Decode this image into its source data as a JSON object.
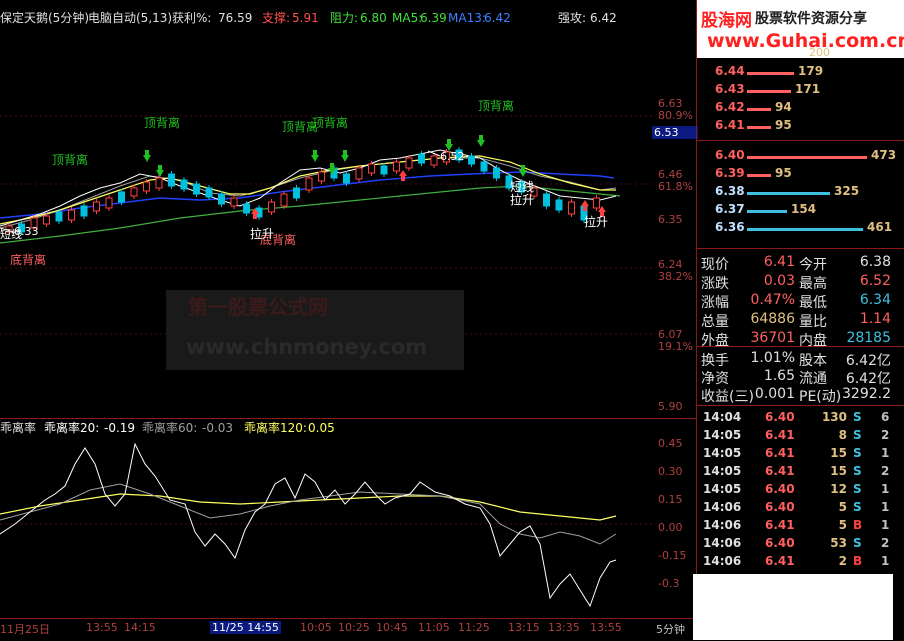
{
  "header": {
    "stock_name": "保定天鹅(5分钟)",
    "formula": "电脑自动(5,13)",
    "profit_label": "获利%:",
    "profit_value": "76.59",
    "support_label": "支撑:",
    "support_value": "5.91",
    "resist_label": "阻力:",
    "resist_value": "6.80",
    "ma5_label": "MA5:",
    "ma5_value": "6.39",
    "ma13_label": "MA13:",
    "ma13_value": "6.42",
    "strong_label": "强攻:",
    "strong_value": "6.42"
  },
  "main_chart": {
    "annotations": [
      {
        "id": "a1",
        "text": "顶背离"
      },
      {
        "id": "a2",
        "text": "顶背离"
      },
      {
        "id": "a3",
        "text": "顶背离"
      },
      {
        "id": "a4",
        "text": "顶背离"
      },
      {
        "id": "a5",
        "text": "顶背离"
      },
      {
        "id": "a6",
        "text": "底背离"
      },
      {
        "id": "a7",
        "text": "底背离"
      },
      {
        "id": "a8",
        "text": "拉升"
      },
      {
        "id": "a9",
        "text": "拉升"
      },
      {
        "id": "a10",
        "text": "拉升"
      },
      {
        "id": "a11",
        "text": "短线"
      },
      {
        "id": "a12",
        "text": "6.52"
      },
      {
        "id": "a13",
        "text": "6.33"
      },
      {
        "id": "a14",
        "text": "短线"
      }
    ],
    "right_axis": [
      {
        "id": "p1",
        "price": "6.63",
        "pct": "80.9%"
      },
      {
        "id": "p2",
        "price": "6.53",
        "pct": ""
      },
      {
        "id": "p3",
        "price": "6.46",
        "pct": "61.8%"
      },
      {
        "id": "p4",
        "price": "6.35",
        "pct": ""
      },
      {
        "id": "p5",
        "price": "6.24",
        "pct": "38.2%"
      },
      {
        "id": "p6",
        "price": "6.07",
        "pct": "19.1%"
      },
      {
        "id": "p7",
        "price": "5.90",
        "pct": ""
      }
    ],
    "watermark_line1": "第一股票公式网",
    "watermark_line2": "www.chnmoney.com"
  },
  "indicator": {
    "name": "乖离率",
    "l1_label": "乖离率20:",
    "l1_value": "-0.19",
    "l2_label": "乖离率60:",
    "l2_value": "-0.03",
    "l3_label": "乖离率120:",
    "l3_value": "0.05",
    "axis": [
      "0.45",
      "0.30",
      "0.15",
      "0.00",
      "-0.15",
      "-0.3"
    ]
  },
  "time_axis": {
    "labels": [
      "11月25日",
      "13:55",
      "14:15",
      "11/25 14:55",
      "10:05",
      "10:25",
      "10:45",
      "11:05",
      "11:25",
      "13:15",
      "13:35",
      "13:55",
      "5分钟"
    ]
  },
  "banner": {
    "logo_text": "股海网",
    "slogan": "股票软件资源分享",
    "url": "www.Guhai.com.cn",
    "partial": "200"
  },
  "order_book": {
    "asks": [
      {
        "price": "6.44",
        "vol": "179",
        "fill": 0.39
      },
      {
        "price": "6.43",
        "vol": "171",
        "fill": 0.37
      },
      {
        "price": "6.42",
        "vol": "94",
        "fill": 0.2
      },
      {
        "price": "6.41",
        "vol": "95",
        "fill": 0.2
      }
    ],
    "bids": [
      {
        "price": "6.40",
        "vol": "473",
        "fill": 1.0
      },
      {
        "price": "6.39",
        "vol": "95",
        "fill": 0.2
      },
      {
        "price": "6.38",
        "vol": "325",
        "fill": 0.69
      },
      {
        "price": "6.37",
        "vol": "154",
        "fill": 0.33
      },
      {
        "price": "6.36",
        "vol": "461",
        "fill": 0.97
      }
    ]
  },
  "quote": [
    {
      "l1": "现价",
      "v1": "6.41",
      "l2": "今开",
      "v2": "6.38"
    },
    {
      "l1": "涨跌",
      "v1": "0.03",
      "l2": "最高",
      "v2": "6.52"
    },
    {
      "l1": "涨幅",
      "v1": "0.47%",
      "l2": "最低",
      "v2": "6.34"
    },
    {
      "l1": "总量",
      "v1": "64886",
      "l2": "量比",
      "v2": "1.14"
    },
    {
      "l1": "外盘",
      "v1": "36701",
      "l2": "内盘",
      "v2": "28185"
    },
    {
      "l1": "换手",
      "v1": "1.01%",
      "l2": "股本",
      "v2": "6.42亿"
    },
    {
      "l1": "净资",
      "v1": "1.65",
      "l2": "流通",
      "v2": "6.42亿"
    },
    {
      "l1": "收益(三)",
      "v1": "0.001",
      "l2": "PE(动)",
      "v2": "3292.2"
    }
  ],
  "trades": [
    {
      "time": "14:04",
      "price": "6.40",
      "vol": "130",
      "side": "S",
      "n": "6"
    },
    {
      "time": "14:05",
      "price": "6.41",
      "vol": "8",
      "side": "S",
      "n": "2"
    },
    {
      "time": "14:05",
      "price": "6.41",
      "vol": "15",
      "side": "S",
      "n": "1"
    },
    {
      "time": "14:05",
      "price": "6.41",
      "vol": "15",
      "side": "S",
      "n": "2"
    },
    {
      "time": "14:05",
      "price": "6.40",
      "vol": "12",
      "side": "S",
      "n": "1"
    },
    {
      "time": "14:06",
      "price": "6.40",
      "vol": "5",
      "side": "S",
      "n": "1"
    },
    {
      "time": "14:06",
      "price": "6.41",
      "vol": "5",
      "side": "B",
      "n": "1"
    },
    {
      "time": "14:06",
      "price": "6.40",
      "vol": "53",
      "side": "S",
      "n": "2"
    },
    {
      "time": "14:06",
      "price": "6.41",
      "vol": "2",
      "side": "B",
      "n": "1"
    }
  ],
  "colors": {
    "up": "#ff4040",
    "down": "#00c0e0",
    "ma5": "#ffffff",
    "ma13": "#ffff60",
    "ma_green": "#40c040",
    "ma_blue": "#2040ff",
    "ma_grey": "#a0a0a0",
    "axis": "#b04040"
  }
}
